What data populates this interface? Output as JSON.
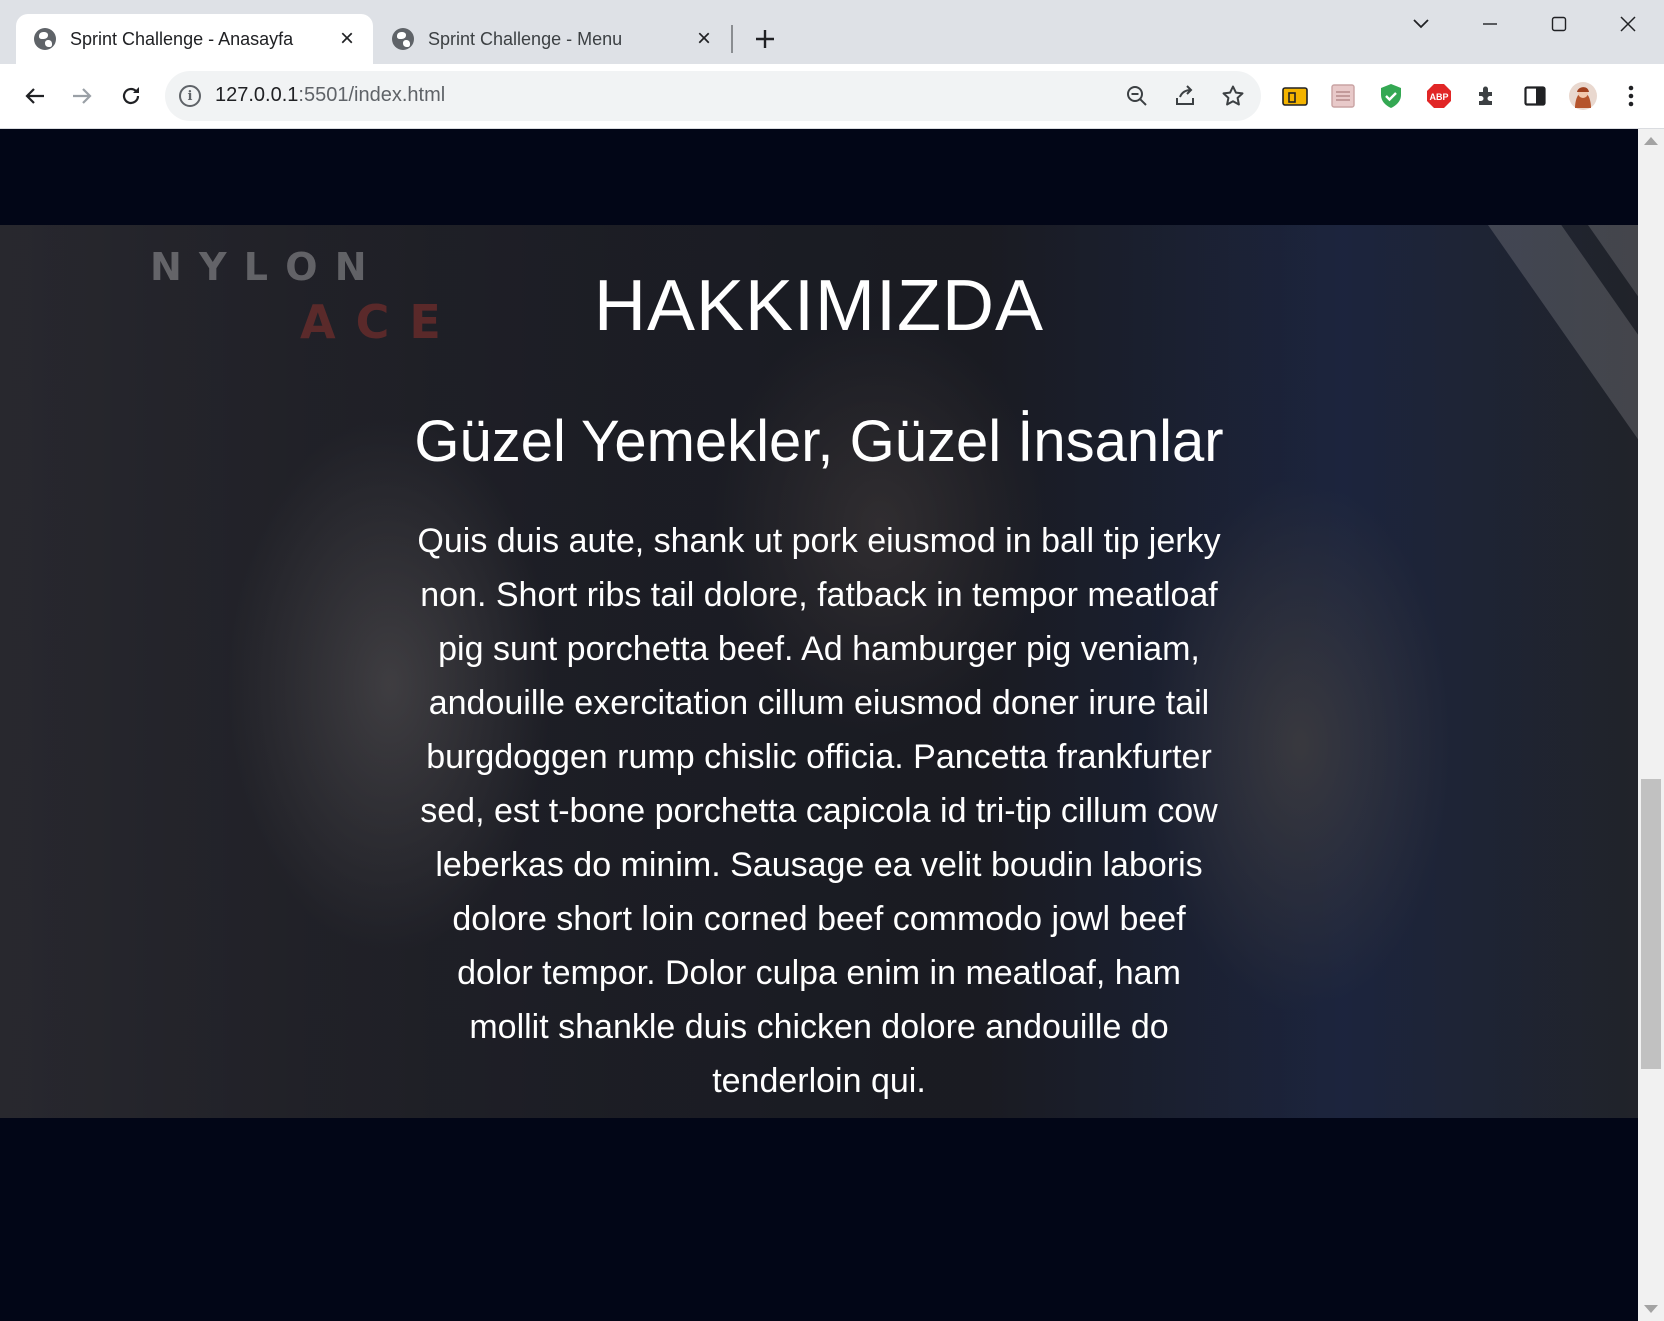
{
  "browser": {
    "tabs": [
      {
        "title": "Sprint Challenge - Anasayfa",
        "active": true
      },
      {
        "title": "Sprint Challenge - Menu",
        "active": false
      }
    ],
    "url_host": "127.0.0.1",
    "url_rest": ":5501/index.html",
    "icons": {
      "back": "arrow-left-icon",
      "forward": "arrow-right-icon",
      "reload": "reload-icon",
      "site_info": "info-icon",
      "zoom": "zoom-out-icon",
      "share": "share-icon",
      "bookmark": "star-icon",
      "extensions": "puzzle-icon",
      "side_panel": "side-panel-icon",
      "menu": "kebab-menu-icon"
    },
    "extension_abp_label": "ABP"
  },
  "page": {
    "about_title": "HAKKIMIZDA",
    "about_subtitle": "Güzel Yemekler, Güzel İnsanlar",
    "about_text": "Quis duis aute, shank ut pork eiusmod in ball tip jerky non. Short ribs tail dolore, fatback in tempor meatloaf pig sunt porchetta beef. Ad hamburger pig veniam, andouille exercitation cillum eiusmod doner irure tail burgdoggen rump chislic officia. Pancetta frankfurter sed, est t-bone porchetta capicola id tri-tip cillum cow leberkas do minim. Sausage ea velit boudin laboris dolore short loin corned beef commodo jowl beef dolor tempor. Dolor culpa enim in meatloaf, ham mollit shankle duis chicken dolore andouille do tenderloin qui.",
    "background_color": "#020617"
  }
}
